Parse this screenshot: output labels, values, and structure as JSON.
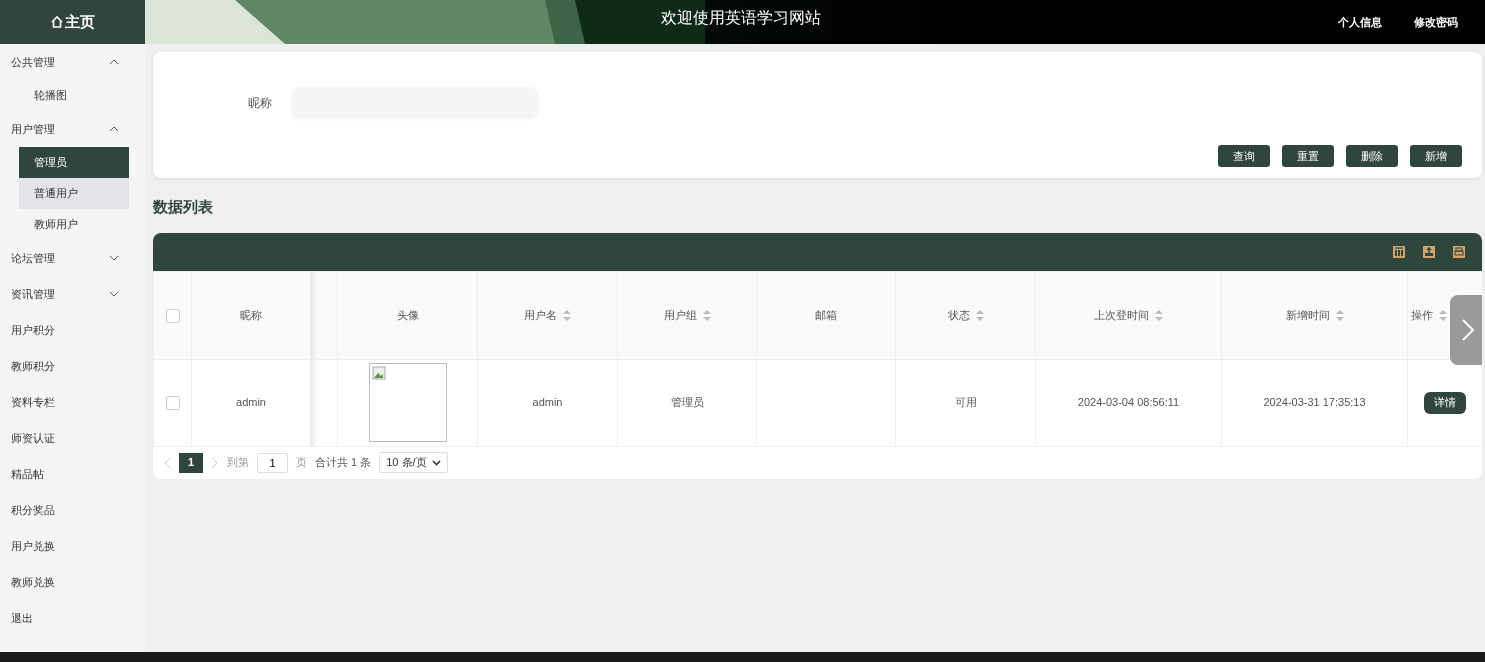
{
  "sidebar": {
    "home": "主页",
    "items": [
      {
        "label": "公共管理",
        "expanded": true,
        "children": [
          {
            "label": "轮播图",
            "selected": false,
            "hovered": false
          }
        ]
      },
      {
        "label": "用户管理",
        "expanded": true,
        "children": [
          {
            "label": "管理员",
            "selected": true,
            "hovered": false
          },
          {
            "label": "普通用户",
            "selected": false,
            "hovered": true
          },
          {
            "label": "教师用户",
            "selected": false,
            "hovered": false
          }
        ]
      },
      {
        "label": "论坛管理",
        "expanded": false
      },
      {
        "label": "资讯管理",
        "expanded": false
      },
      {
        "label": "用户积分"
      },
      {
        "label": "教师积分"
      },
      {
        "label": "资料专栏"
      },
      {
        "label": "师资认证"
      },
      {
        "label": "精品帖"
      },
      {
        "label": "积分奖品"
      },
      {
        "label": "用户兑换"
      },
      {
        "label": "教师兑换"
      },
      {
        "label": "退出"
      }
    ]
  },
  "header": {
    "title": "欢迎使用英语学习网站",
    "links": [
      "个人信息",
      "修改密码"
    ]
  },
  "search": {
    "label": "昵称",
    "buttons": [
      "查询",
      "重置",
      "删除",
      "新增"
    ]
  },
  "list_title": "数据列表",
  "table": {
    "select_all": {
      "checked": false
    },
    "columns": [
      {
        "label": "昵称",
        "sortable": false
      },
      {
        "kind": "blank"
      },
      {
        "label": "头像",
        "sortable": false
      },
      {
        "label": "用户名",
        "sortable": true
      },
      {
        "label": "用户组",
        "sortable": true
      },
      {
        "label": "邮箱",
        "sortable": false
      },
      {
        "label": "状态",
        "sortable": true
      },
      {
        "label": "上次登时间",
        "sortable": true
      },
      {
        "label": "新增时间",
        "sortable": true
      },
      {
        "label": "操作",
        "sortable": true
      }
    ],
    "rows": [
      {
        "checked": false,
        "cells": [
          "admin",
          "",
          "",
          "admin",
          "管理员",
          "",
          "可用",
          "2024-03-04 08:56:11",
          "2024-03-31 17:35:13",
          "详情"
        ]
      }
    ]
  },
  "pagination": {
    "pages": [
      {
        "label": "1",
        "selected": true
      }
    ],
    "goto_label": "到第",
    "goto_value": "1",
    "page_unit": "页",
    "total": "合计共 1 条",
    "page_size": "10 条/页"
  }
}
